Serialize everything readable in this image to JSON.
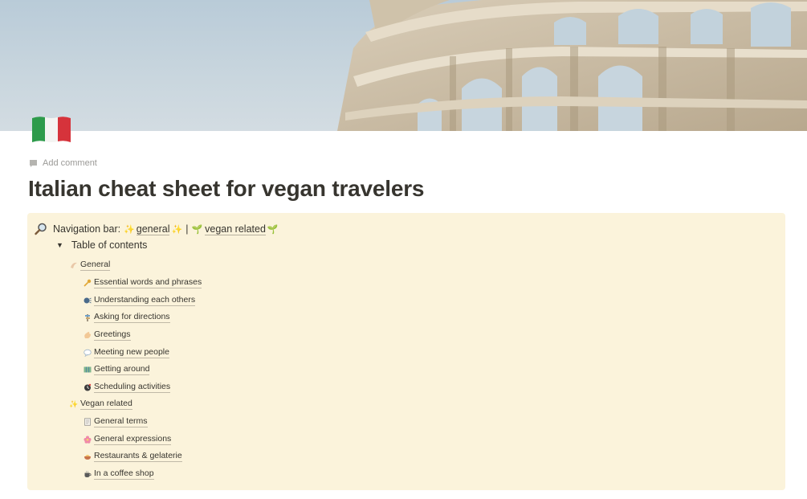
{
  "page": {
    "title": "Italian cheat sheet for vegan travelers",
    "add_comment": "Add comment",
    "icon": "italy-flag-icon",
    "cover": "colosseum-photo"
  },
  "navigation": {
    "prefix": "Navigation bar:",
    "general_label": "general",
    "separator": "|",
    "vegan_label": "vegan related"
  },
  "toc": {
    "toggle_label": "Table of contents",
    "sections": [
      {
        "label": "General",
        "icon": "wave-icon",
        "items": [
          {
            "label": "Essential words and phrases",
            "icon": "key-icon"
          },
          {
            "label": "Understanding each others",
            "icon": "speaking-head-icon"
          },
          {
            "label": "Asking for directions",
            "icon": "signpost-icon"
          },
          {
            "label": "Greetings",
            "icon": "waving-hand-icon"
          },
          {
            "label": "Meeting new people",
            "icon": "speech-bubble-icon"
          },
          {
            "label": "Getting around",
            "icon": "map-icon"
          },
          {
            "label": "Scheduling activities",
            "icon": "clock-icon"
          }
        ]
      },
      {
        "label": "Vegan related",
        "icon": "sparkles-icon",
        "items": [
          {
            "label": "General terms",
            "icon": "notebook-icon"
          },
          {
            "label": "General expressions",
            "icon": "blossom-icon"
          },
          {
            "label": "Restaurants & gelaterie",
            "icon": "food-icon"
          },
          {
            "label": "In a coffee shop",
            "icon": "coffee-icon"
          }
        ]
      }
    ]
  },
  "colors": {
    "callout_bg": "#fbf3db",
    "text": "#37352f",
    "muted": "#9b9a97"
  }
}
